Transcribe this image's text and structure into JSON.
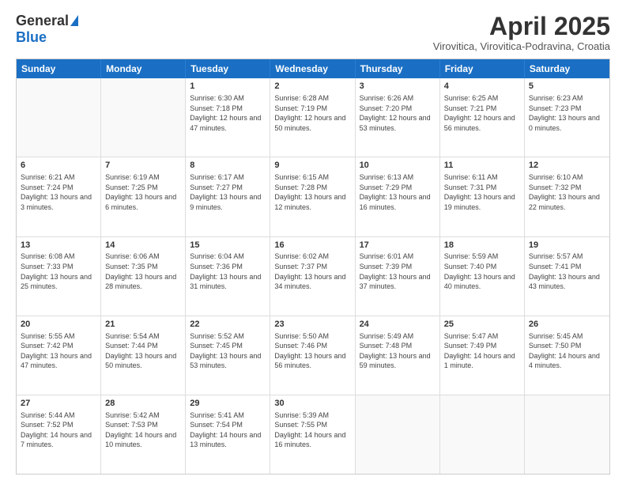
{
  "logo": {
    "general": "General",
    "blue": "Blue"
  },
  "title": "April 2025",
  "subtitle": "Virovitica, Virovitica-Podravina, Croatia",
  "days": [
    "Sunday",
    "Monday",
    "Tuesday",
    "Wednesday",
    "Thursday",
    "Friday",
    "Saturday"
  ],
  "weeks": [
    [
      {
        "day": "",
        "info": ""
      },
      {
        "day": "",
        "info": ""
      },
      {
        "day": "1",
        "info": "Sunrise: 6:30 AM\nSunset: 7:18 PM\nDaylight: 12 hours and 47 minutes."
      },
      {
        "day": "2",
        "info": "Sunrise: 6:28 AM\nSunset: 7:19 PM\nDaylight: 12 hours and 50 minutes."
      },
      {
        "day": "3",
        "info": "Sunrise: 6:26 AM\nSunset: 7:20 PM\nDaylight: 12 hours and 53 minutes."
      },
      {
        "day": "4",
        "info": "Sunrise: 6:25 AM\nSunset: 7:21 PM\nDaylight: 12 hours and 56 minutes."
      },
      {
        "day": "5",
        "info": "Sunrise: 6:23 AM\nSunset: 7:23 PM\nDaylight: 13 hours and 0 minutes."
      }
    ],
    [
      {
        "day": "6",
        "info": "Sunrise: 6:21 AM\nSunset: 7:24 PM\nDaylight: 13 hours and 3 minutes."
      },
      {
        "day": "7",
        "info": "Sunrise: 6:19 AM\nSunset: 7:25 PM\nDaylight: 13 hours and 6 minutes."
      },
      {
        "day": "8",
        "info": "Sunrise: 6:17 AM\nSunset: 7:27 PM\nDaylight: 13 hours and 9 minutes."
      },
      {
        "day": "9",
        "info": "Sunrise: 6:15 AM\nSunset: 7:28 PM\nDaylight: 13 hours and 12 minutes."
      },
      {
        "day": "10",
        "info": "Sunrise: 6:13 AM\nSunset: 7:29 PM\nDaylight: 13 hours and 16 minutes."
      },
      {
        "day": "11",
        "info": "Sunrise: 6:11 AM\nSunset: 7:31 PM\nDaylight: 13 hours and 19 minutes."
      },
      {
        "day": "12",
        "info": "Sunrise: 6:10 AM\nSunset: 7:32 PM\nDaylight: 13 hours and 22 minutes."
      }
    ],
    [
      {
        "day": "13",
        "info": "Sunrise: 6:08 AM\nSunset: 7:33 PM\nDaylight: 13 hours and 25 minutes."
      },
      {
        "day": "14",
        "info": "Sunrise: 6:06 AM\nSunset: 7:35 PM\nDaylight: 13 hours and 28 minutes."
      },
      {
        "day": "15",
        "info": "Sunrise: 6:04 AM\nSunset: 7:36 PM\nDaylight: 13 hours and 31 minutes."
      },
      {
        "day": "16",
        "info": "Sunrise: 6:02 AM\nSunset: 7:37 PM\nDaylight: 13 hours and 34 minutes."
      },
      {
        "day": "17",
        "info": "Sunrise: 6:01 AM\nSunset: 7:39 PM\nDaylight: 13 hours and 37 minutes."
      },
      {
        "day": "18",
        "info": "Sunrise: 5:59 AM\nSunset: 7:40 PM\nDaylight: 13 hours and 40 minutes."
      },
      {
        "day": "19",
        "info": "Sunrise: 5:57 AM\nSunset: 7:41 PM\nDaylight: 13 hours and 43 minutes."
      }
    ],
    [
      {
        "day": "20",
        "info": "Sunrise: 5:55 AM\nSunset: 7:42 PM\nDaylight: 13 hours and 47 minutes."
      },
      {
        "day": "21",
        "info": "Sunrise: 5:54 AM\nSunset: 7:44 PM\nDaylight: 13 hours and 50 minutes."
      },
      {
        "day": "22",
        "info": "Sunrise: 5:52 AM\nSunset: 7:45 PM\nDaylight: 13 hours and 53 minutes."
      },
      {
        "day": "23",
        "info": "Sunrise: 5:50 AM\nSunset: 7:46 PM\nDaylight: 13 hours and 56 minutes."
      },
      {
        "day": "24",
        "info": "Sunrise: 5:49 AM\nSunset: 7:48 PM\nDaylight: 13 hours and 59 minutes."
      },
      {
        "day": "25",
        "info": "Sunrise: 5:47 AM\nSunset: 7:49 PM\nDaylight: 14 hours and 1 minute."
      },
      {
        "day": "26",
        "info": "Sunrise: 5:45 AM\nSunset: 7:50 PM\nDaylight: 14 hours and 4 minutes."
      }
    ],
    [
      {
        "day": "27",
        "info": "Sunrise: 5:44 AM\nSunset: 7:52 PM\nDaylight: 14 hours and 7 minutes."
      },
      {
        "day": "28",
        "info": "Sunrise: 5:42 AM\nSunset: 7:53 PM\nDaylight: 14 hours and 10 minutes."
      },
      {
        "day": "29",
        "info": "Sunrise: 5:41 AM\nSunset: 7:54 PM\nDaylight: 14 hours and 13 minutes."
      },
      {
        "day": "30",
        "info": "Sunrise: 5:39 AM\nSunset: 7:55 PM\nDaylight: 14 hours and 16 minutes."
      },
      {
        "day": "",
        "info": ""
      },
      {
        "day": "",
        "info": ""
      },
      {
        "day": "",
        "info": ""
      }
    ]
  ]
}
